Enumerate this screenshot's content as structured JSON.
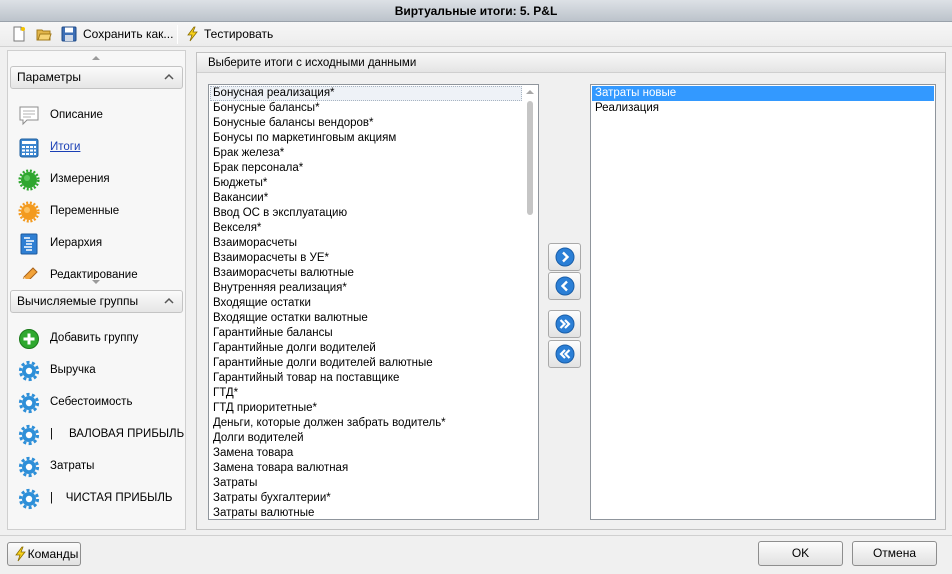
{
  "window": {
    "title": "Виртуальные итоги: 5. P&L"
  },
  "toolbar": {
    "new_icon": "new-document-icon",
    "open_icon": "open-folder-icon",
    "save_icon": "save-icon",
    "save_as_label": "Сохранить как...",
    "test_icon": "lightning-icon",
    "test_label": "Тестировать"
  },
  "sidebar": {
    "params": {
      "title": "Параметры",
      "items": [
        {
          "label": "Описание",
          "icon": "description-icon"
        },
        {
          "label": "Итоги",
          "icon": "calculator-icon",
          "active": true
        },
        {
          "label": "Измерения",
          "icon": "green-gear-icon"
        },
        {
          "label": "Переменные",
          "icon": "orange-gear-icon"
        },
        {
          "label": "Иерархия",
          "icon": "hierarchy-icon"
        },
        {
          "label": "Редактирование",
          "icon": "pencil-icon"
        }
      ]
    },
    "groups": {
      "title": "Вычисляемые группы",
      "items": [
        {
          "label": "Добавить группу",
          "icon": "add-icon"
        },
        {
          "label": "Выручка",
          "icon": "gear-icon"
        },
        {
          "label": "Себестоимость",
          "icon": "gear-icon"
        },
        {
          "label": "|     ВАЛОВАЯ ПРИБЫЛЬ",
          "icon": "gear-icon"
        },
        {
          "label": "Затраты",
          "icon": "gear-icon"
        },
        {
          "label": "|    ЧИСТАЯ ПРИБЫЛЬ",
          "icon": "gear-icon"
        }
      ]
    }
  },
  "main": {
    "header": "Выберите итоги с исходными данными",
    "available": [
      {
        "label": "Бонусная реализация*",
        "highlighted": true
      },
      {
        "label": "Бонусные балансы*"
      },
      {
        "label": "Бонусные балансы вендоров*"
      },
      {
        "label": "Бонусы по маркетинговым акциям"
      },
      {
        "label": "Брак железа*"
      },
      {
        "label": "Брак персонала*"
      },
      {
        "label": "Бюджеты*"
      },
      {
        "label": "Вакансии*"
      },
      {
        "label": "Ввод ОС в эксплуатацию"
      },
      {
        "label": "Векселя*"
      },
      {
        "label": "Взаиморасчеты"
      },
      {
        "label": "Взаиморасчеты в УЕ*"
      },
      {
        "label": "Взаиморасчеты валютные"
      },
      {
        "label": "Внутренняя реализация*"
      },
      {
        "label": "Входящие остатки"
      },
      {
        "label": "Входящие остатки валютные"
      },
      {
        "label": "Гарантийные балансы"
      },
      {
        "label": "Гарантийные долги водителей"
      },
      {
        "label": "Гарантийные долги водителей валютные"
      },
      {
        "label": "Гарантийный товар на поставщике"
      },
      {
        "label": "ГТД*"
      },
      {
        "label": "ГТД приоритетные*"
      },
      {
        "label": "Деньги, которые должен забрать водитель*"
      },
      {
        "label": "Долги водителей"
      },
      {
        "label": "Замена товара"
      },
      {
        "label": "Замена товара валютная"
      },
      {
        "label": "Затраты"
      },
      {
        "label": "Затраты бухгалтерии*"
      },
      {
        "label": "Затраты валютные"
      }
    ],
    "selected": [
      {
        "label": "Затраты новые",
        "selected": true
      },
      {
        "label": "Реализация"
      }
    ],
    "move_buttons": [
      {
        "icon": "chevron-right-icon"
      },
      {
        "icon": "chevron-left-icon"
      },
      {
        "icon": "double-chevron-right-icon"
      },
      {
        "icon": "double-chevron-left-icon"
      }
    ]
  },
  "footer": {
    "commands_label": "Команды",
    "ok_label": "OK",
    "cancel_label": "Отмена"
  },
  "colors": {
    "selection": "#3399ff",
    "link": "#1a3fb5",
    "accent_blue": "#2b7fd6"
  }
}
